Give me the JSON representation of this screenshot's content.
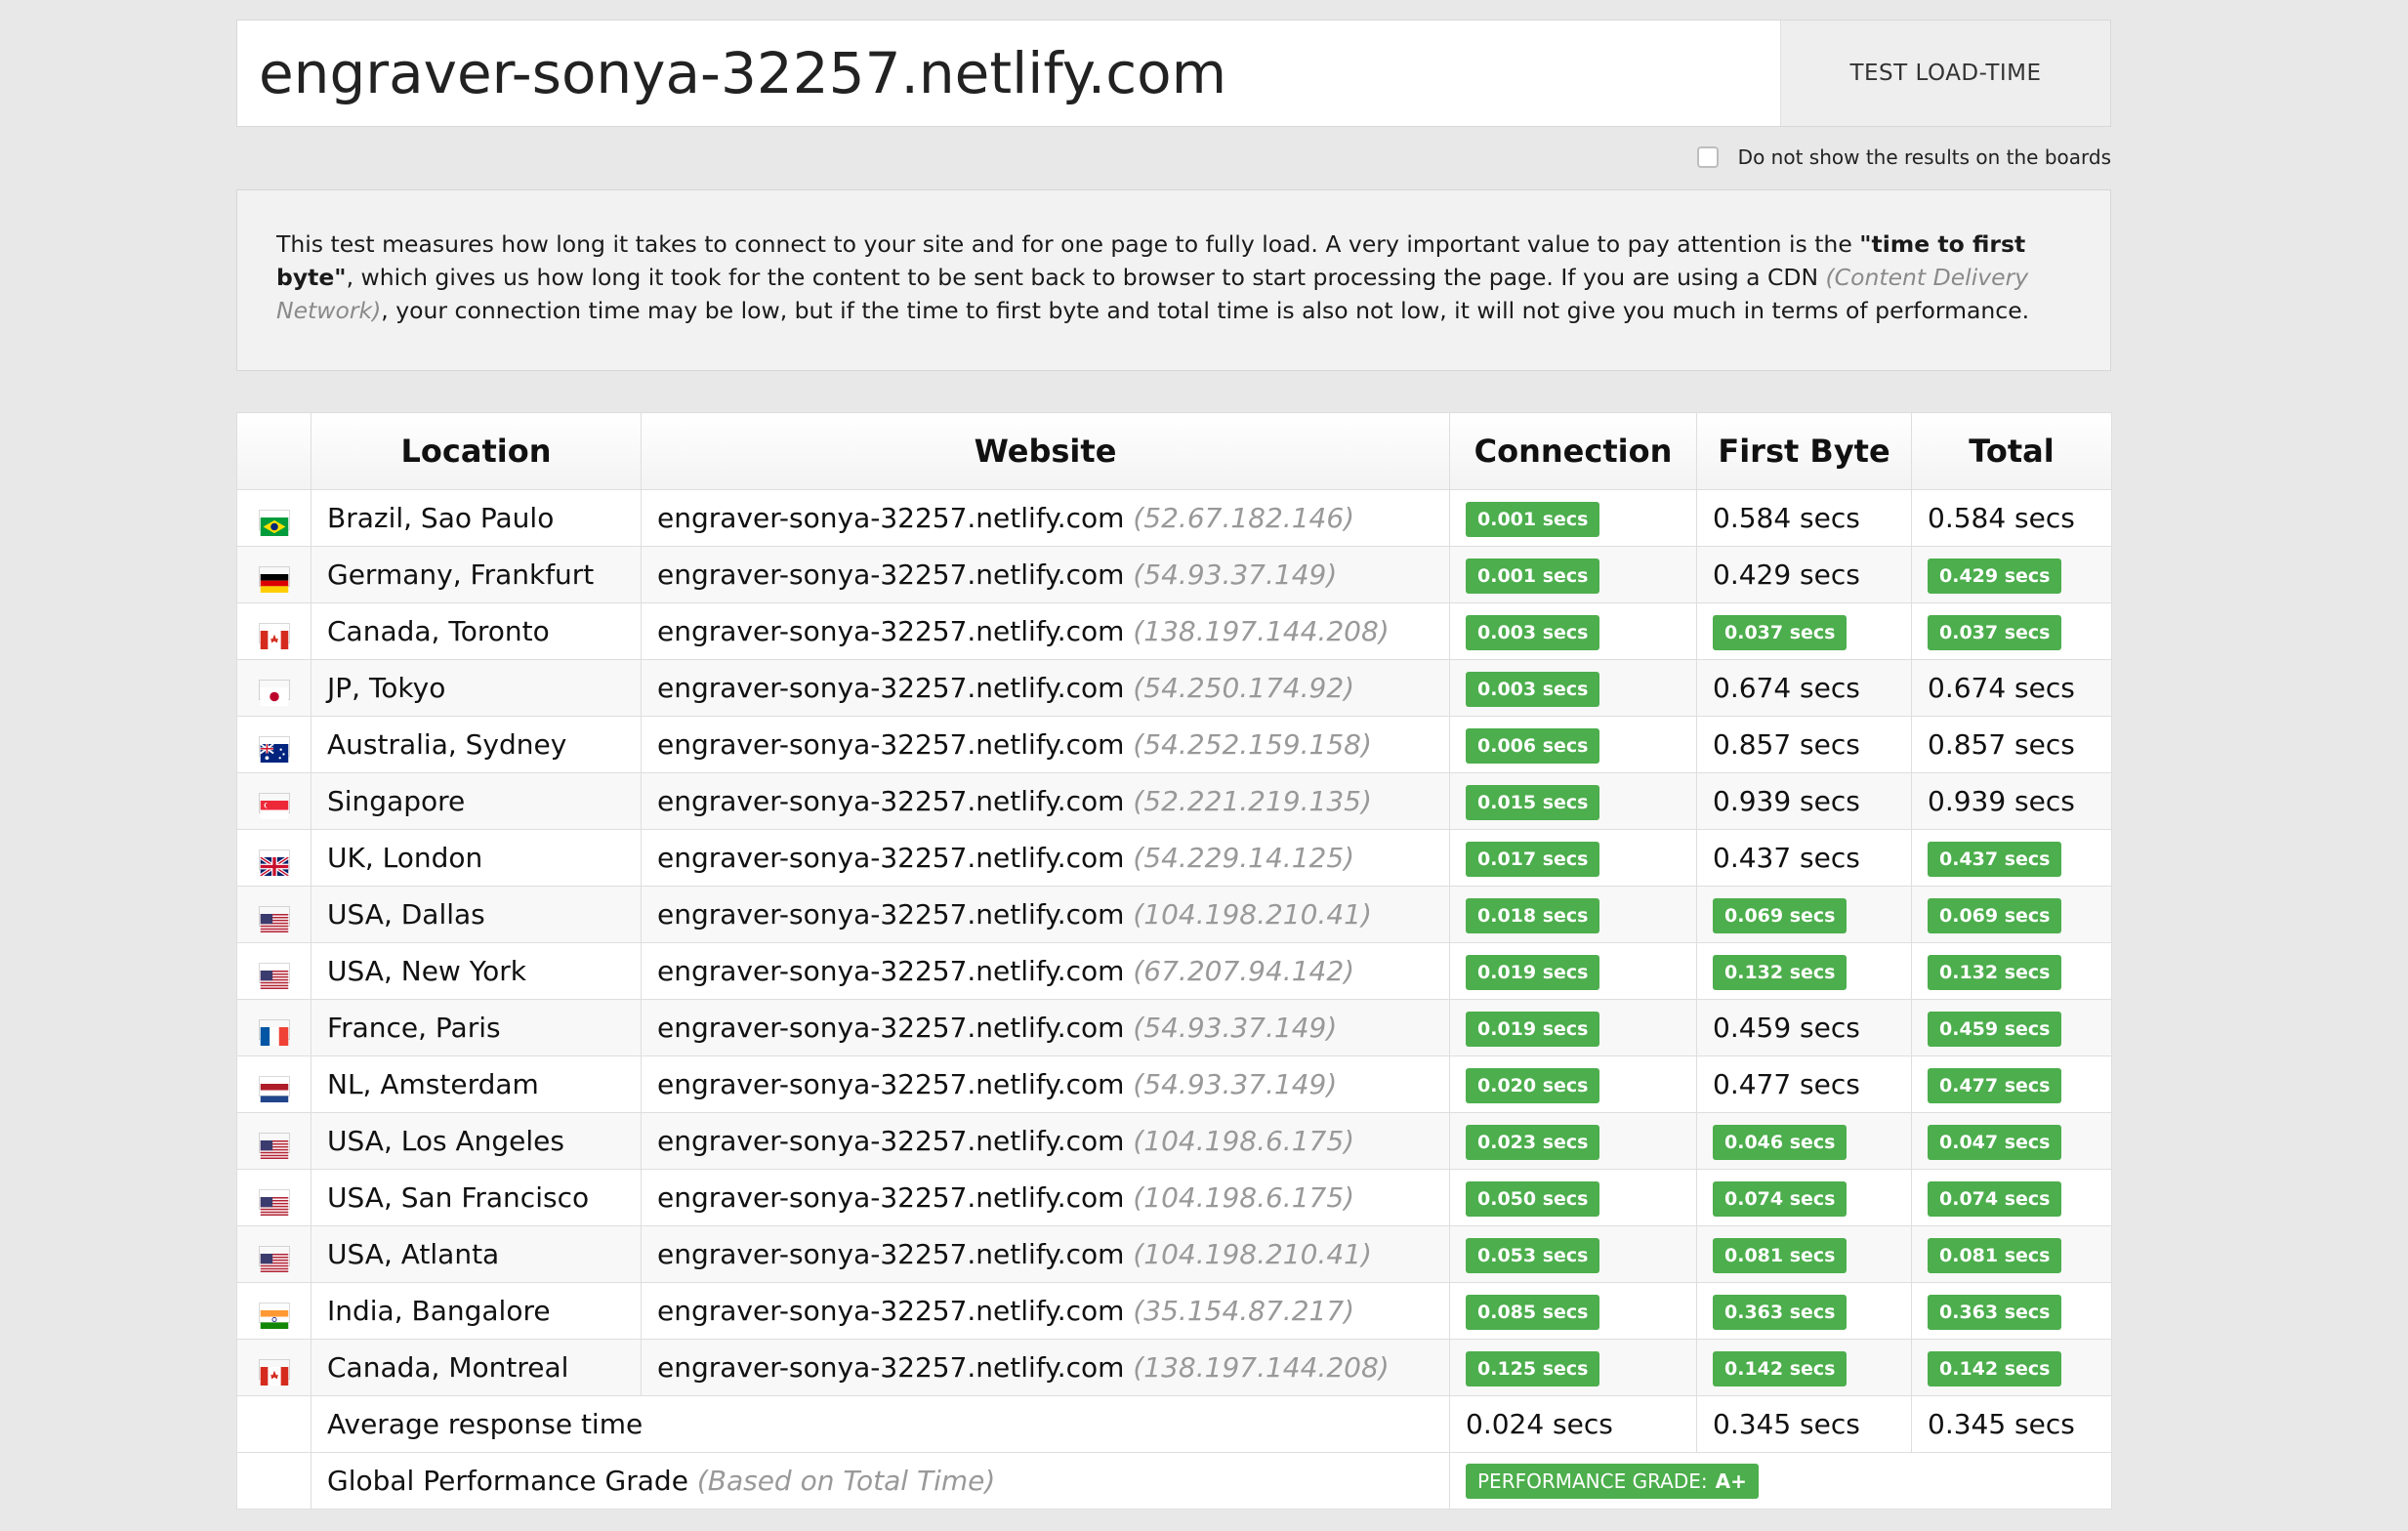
{
  "search": {
    "url_value": "engraver-sonya-32257.netlify.com",
    "button_label": "TEST LOAD-TIME"
  },
  "options": {
    "hide_results_label": "Do not show the results on the boards",
    "hide_results_checked": false
  },
  "info": {
    "part1": "This test measures how long it takes to connect to your site and for one page to fully load. A very important value to pay attention is the ",
    "bold": "\"time to first byte\"",
    "part2": ", which gives us how long it took for the content to be sent back to browser to start processing the page. If you are using a CDN ",
    "muted": "(Content Delivery Network)",
    "part3": ", your connection time may be low, but if the time to first byte and total time is also not low, it will not give you much in terms of performance."
  },
  "table": {
    "headers": [
      "Location",
      "Website",
      "Connection",
      "First Byte",
      "Total"
    ],
    "rows": [
      {
        "flag": "brazil-flag",
        "location": "Brazil, Sao Paulo",
        "website": "engraver-sonya-32257.netlify.com",
        "ip": "(52.67.182.146)",
        "connection": "0.001 secs",
        "connection_badge": true,
        "first_byte": "0.584 secs",
        "first_byte_badge": false,
        "total": "0.584 secs",
        "total_badge": false
      },
      {
        "flag": "germany-flag",
        "location": "Germany, Frankfurt",
        "website": "engraver-sonya-32257.netlify.com",
        "ip": "(54.93.37.149)",
        "connection": "0.001 secs",
        "connection_badge": true,
        "first_byte": "0.429 secs",
        "first_byte_badge": false,
        "total": "0.429 secs",
        "total_badge": true
      },
      {
        "flag": "canada-flag",
        "location": "Canada, Toronto",
        "website": "engraver-sonya-32257.netlify.com",
        "ip": "(138.197.144.208)",
        "connection": "0.003 secs",
        "connection_badge": true,
        "first_byte": "0.037 secs",
        "first_byte_badge": true,
        "total": "0.037 secs",
        "total_badge": true
      },
      {
        "flag": "japan-flag",
        "location": "JP, Tokyo",
        "website": "engraver-sonya-32257.netlify.com",
        "ip": "(54.250.174.92)",
        "connection": "0.003 secs",
        "connection_badge": true,
        "first_byte": "0.674 secs",
        "first_byte_badge": false,
        "total": "0.674 secs",
        "total_badge": false
      },
      {
        "flag": "australia-flag",
        "location": "Australia, Sydney",
        "website": "engraver-sonya-32257.netlify.com",
        "ip": "(54.252.159.158)",
        "connection": "0.006 secs",
        "connection_badge": true,
        "first_byte": "0.857 secs",
        "first_byte_badge": false,
        "total": "0.857 secs",
        "total_badge": false
      },
      {
        "flag": "singapore-flag",
        "location": "Singapore",
        "website": "engraver-sonya-32257.netlify.com",
        "ip": "(52.221.219.135)",
        "connection": "0.015 secs",
        "connection_badge": true,
        "first_byte": "0.939 secs",
        "first_byte_badge": false,
        "total": "0.939 secs",
        "total_badge": false
      },
      {
        "flag": "uk-flag",
        "location": "UK, London",
        "website": "engraver-sonya-32257.netlify.com",
        "ip": "(54.229.14.125)",
        "connection": "0.017 secs",
        "connection_badge": true,
        "first_byte": "0.437 secs",
        "first_byte_badge": false,
        "total": "0.437 secs",
        "total_badge": true
      },
      {
        "flag": "usa-flag",
        "location": "USA, Dallas",
        "website": "engraver-sonya-32257.netlify.com",
        "ip": "(104.198.210.41)",
        "connection": "0.018 secs",
        "connection_badge": true,
        "first_byte": "0.069 secs",
        "first_byte_badge": true,
        "total": "0.069 secs",
        "total_badge": true
      },
      {
        "flag": "usa-flag",
        "location": "USA, New York",
        "website": "engraver-sonya-32257.netlify.com",
        "ip": "(67.207.94.142)",
        "connection": "0.019 secs",
        "connection_badge": true,
        "first_byte": "0.132 secs",
        "first_byte_badge": true,
        "total": "0.132 secs",
        "total_badge": true
      },
      {
        "flag": "france-flag",
        "location": "France, Paris",
        "website": "engraver-sonya-32257.netlify.com",
        "ip": "(54.93.37.149)",
        "connection": "0.019 secs",
        "connection_badge": true,
        "first_byte": "0.459 secs",
        "first_byte_badge": false,
        "total": "0.459 secs",
        "total_badge": true
      },
      {
        "flag": "netherlands-flag",
        "location": "NL, Amsterdam",
        "website": "engraver-sonya-32257.netlify.com",
        "ip": "(54.93.37.149)",
        "connection": "0.020 secs",
        "connection_badge": true,
        "first_byte": "0.477 secs",
        "first_byte_badge": false,
        "total": "0.477 secs",
        "total_badge": true
      },
      {
        "flag": "usa-flag",
        "location": "USA, Los Angeles",
        "website": "engraver-sonya-32257.netlify.com",
        "ip": "(104.198.6.175)",
        "connection": "0.023 secs",
        "connection_badge": true,
        "first_byte": "0.046 secs",
        "first_byte_badge": true,
        "total": "0.047 secs",
        "total_badge": true
      },
      {
        "flag": "usa-flag",
        "location": "USA, San Francisco",
        "website": "engraver-sonya-32257.netlify.com",
        "ip": "(104.198.6.175)",
        "connection": "0.050 secs",
        "connection_badge": true,
        "first_byte": "0.074 secs",
        "first_byte_badge": true,
        "total": "0.074 secs",
        "total_badge": true
      },
      {
        "flag": "usa-flag",
        "location": "USA, Atlanta",
        "website": "engraver-sonya-32257.netlify.com",
        "ip": "(104.198.210.41)",
        "connection": "0.053 secs",
        "connection_badge": true,
        "first_byte": "0.081 secs",
        "first_byte_badge": true,
        "total": "0.081 secs",
        "total_badge": true
      },
      {
        "flag": "india-flag",
        "location": "India, Bangalore",
        "website": "engraver-sonya-32257.netlify.com",
        "ip": "(35.154.87.217)",
        "connection": "0.085 secs",
        "connection_badge": true,
        "first_byte": "0.363 secs",
        "first_byte_badge": true,
        "total": "0.363 secs",
        "total_badge": true
      },
      {
        "flag": "canada-flag",
        "location": "Canada, Montreal",
        "website": "engraver-sonya-32257.netlify.com",
        "ip": "(138.197.144.208)",
        "connection": "0.125 secs",
        "connection_badge": true,
        "first_byte": "0.142 secs",
        "first_byte_badge": true,
        "total": "0.142 secs",
        "total_badge": true
      }
    ],
    "average": {
      "label": "Average response time",
      "connection": "0.024 secs",
      "first_byte": "0.345 secs",
      "total": "0.345 secs"
    },
    "grade": {
      "label": "Global Performance Grade",
      "note": "(Based on Total Time)",
      "badge_label": "PERFORMANCE GRADE:",
      "badge_value": "A+"
    }
  },
  "colors": {
    "badge_green": "#4cae4c",
    "background": "#e8e8e8",
    "muted_text": "#999999"
  }
}
